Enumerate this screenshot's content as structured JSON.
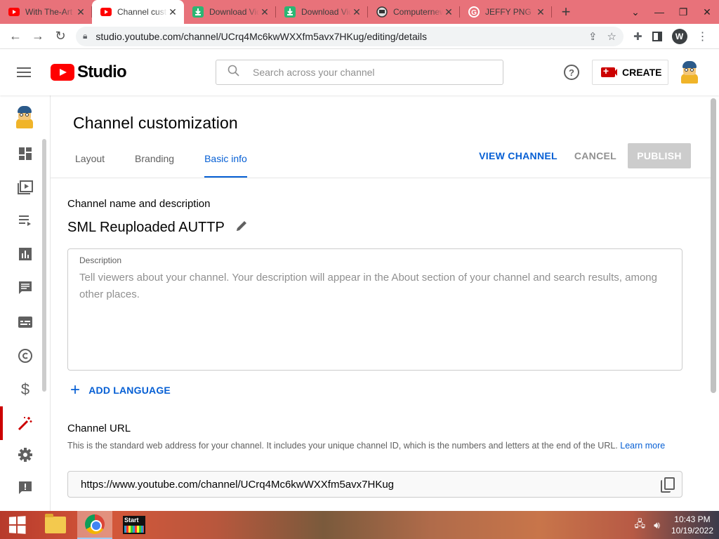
{
  "browser": {
    "tabs": [
      {
        "title": "With The-Art",
        "icon": "youtube-icon",
        "active": false
      },
      {
        "title": "Channel customization",
        "icon": "youtube-icon",
        "active": true
      },
      {
        "title": "Download Videos",
        "icon": "download-icon",
        "active": false
      },
      {
        "title": "Download Videos",
        "icon": "download-icon",
        "active": false
      },
      {
        "title": "Computernewb",
        "icon": "computernewb-icon",
        "active": false
      },
      {
        "title": "JEFFY PNG - Google",
        "icon": "google-icon",
        "active": false
      }
    ],
    "new_tab": "+",
    "address": "studio.youtube.com/channel/UCrq4Mc6kwWXXfm5avx7HKug/editing/details",
    "profile_initial": "W"
  },
  "header": {
    "logo_text": "Studio",
    "search_placeholder": "Search across your channel",
    "help_symbol": "?",
    "create_label": "CREATE"
  },
  "page": {
    "title": "Channel customization",
    "tabs": [
      {
        "label": "Layout",
        "selected": false
      },
      {
        "label": "Branding",
        "selected": false
      },
      {
        "label": "Basic info",
        "selected": true
      }
    ],
    "actions": {
      "view_channel": "VIEW CHANNEL",
      "cancel": "CANCEL",
      "publish": "PUBLISH"
    },
    "name_section": {
      "title": "Channel name and description",
      "channel_name": "SML Reuploaded AUTTP"
    },
    "description": {
      "label": "Description",
      "placeholder": "Tell viewers about your channel. Your description will appear in the About section of your channel and search results, among other places."
    },
    "add_language": "ADD LANGUAGE",
    "url_section": {
      "title": "Channel URL",
      "desc": "This is the standard web address for your channel. It includes your unique channel ID, which is the numbers and letters at the end of the URL.",
      "learn_more": "Learn more",
      "url": "https://www.youtube.com/channel/UCrq4Mc6kwWXXfm5avx7HKug"
    }
  },
  "taskbar": {
    "time": "10:43 PM",
    "date": "10/19/2022",
    "start_app_label": "Start"
  },
  "colors": {
    "accent_blue": "#065fd4",
    "youtube_red": "#ff0000",
    "active_nav": "#cc0000",
    "tabstrip": "#e8727a"
  }
}
